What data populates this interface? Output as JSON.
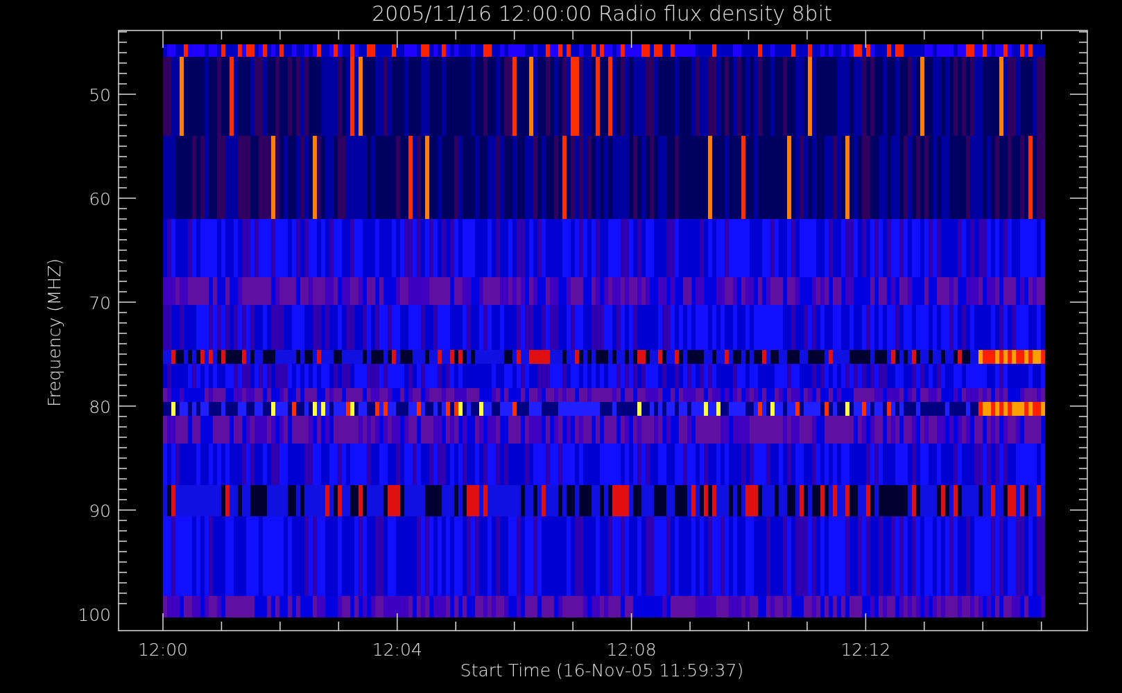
{
  "title": "2005/11/16 12:00:00 Radio flux density 8bit",
  "y_axis": {
    "label": "Frequency (MHZ)",
    "ticks": [
      "50",
      "60",
      "70",
      "80",
      "90",
      "100"
    ]
  },
  "x_axis": {
    "label": "Start Time (16-Nov-05 11:59:37)",
    "ticks": [
      "12:00",
      "12:04",
      "12:08",
      "12:12"
    ]
  }
}
